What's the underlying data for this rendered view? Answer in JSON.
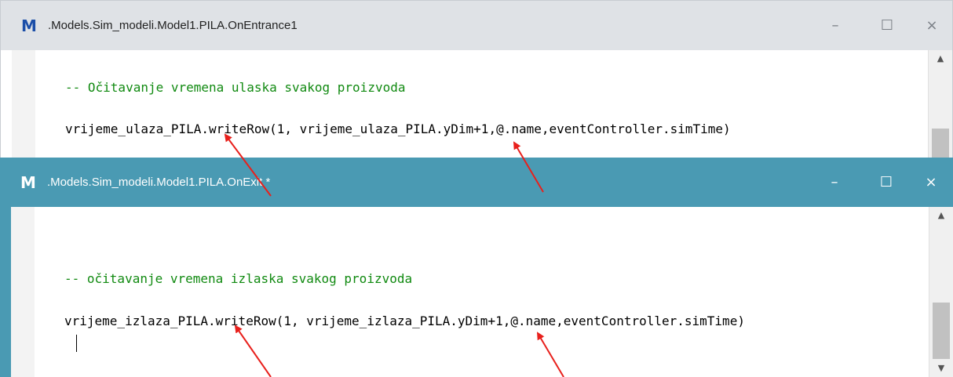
{
  "windows": [
    {
      "title": ".Models.Sim_modeli.Model1.PILA.OnEntrance1",
      "icon": "M",
      "controls": {
        "minimize": "–",
        "maximize": "☐",
        "close": "×"
      },
      "code": {
        "comment": "-- Očitavanje vremena ulaska svakog proizvoda",
        "statement": "vrijeme_ulaza_PILA.writeRow(1, vrijeme_ulaza_PILA.yDim+1,@.name,eventController.simTime)"
      }
    },
    {
      "title": ".Models.Sim_modeli.Model1.PILA.OnExit *",
      "icon": "M",
      "controls": {
        "minimize": "–",
        "maximize": "☐",
        "close": "×"
      },
      "code": {
        "comment": "-- očitavanje vremena izlaska svakog proizvoda",
        "statement": "vrijeme_izlaza_PILA.writeRow(1, vrijeme_izlaza_PILA.yDim+1,@.name,eventController.simTime)"
      }
    }
  ],
  "scrollbar": {
    "up": "▲",
    "down": "▼"
  },
  "colors": {
    "active_title": "#4a9ab3",
    "inactive_title": "#dfe2e6",
    "comment": "#118a11",
    "arrow": "#e8201c"
  }
}
